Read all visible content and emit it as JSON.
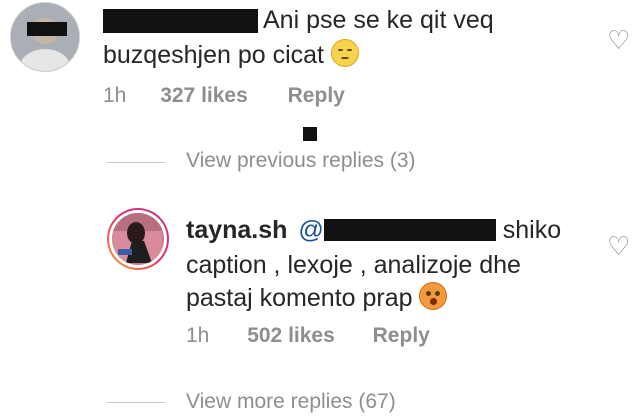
{
  "comment1": {
    "text_line1": "Ani pse se ke qit veq",
    "text_line2": "buzqeshjen po cicat",
    "emoji": "relieved-face",
    "time": "1h",
    "likes": "327 likes",
    "reply": "Reply"
  },
  "view_previous": "View previous replies (3)",
  "comment2": {
    "username": "tayna.sh",
    "mention_prefix": "@",
    "text_line1_after": "shiko",
    "text_line2": "caption , lexoje , analizoje dhe",
    "text_line3": "pastaj komento prap",
    "emoji": "hushed-face",
    "time": "1h",
    "likes": "502 likes",
    "reply": "Reply"
  },
  "view_more": "View more replies (67)",
  "icons": {
    "like": "heart-outline-icon"
  }
}
